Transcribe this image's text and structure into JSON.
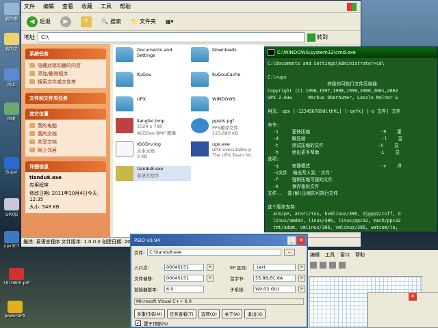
{
  "desktop": {
    "icons": [
      "我的电",
      "我的文",
      "",
      "网上",
      "",
      "回收",
      "",
      "Super",
      "",
      "UPX加",
      "",
      "upx307",
      "",
      "1910800.pdf",
      "",
      "powerUPX"
    ]
  },
  "explorer": {
    "menu": [
      "文件",
      "编辑",
      "查看",
      "收藏",
      "工具",
      "帮助"
    ],
    "toolbar": {
      "back": "后退",
      "search": "搜索",
      "folders": "文件夹"
    },
    "address_label": "地址",
    "address_value": "C:\\",
    "go": "转到",
    "system_tasks": {
      "title": "系统任务",
      "items": [
        "隐藏此驱动器的内容",
        "添加/删除程序",
        "搜索文件或文件夹"
      ]
    },
    "file_tasks": {
      "title": "文件和文件夹任务"
    },
    "other_places": {
      "title": "其它位置",
      "items": [
        "我的电脑",
        "我的文档",
        "共享文档",
        "网上邻居"
      ]
    },
    "details": {
      "title": "详细信息",
      "name": "tiandu8.exe",
      "type": "应用程序",
      "modified": "修改日期: 2011年10月4日今天, 12:35",
      "size": "大小: 548 KB"
    },
    "files": [
      {
        "name": "Documents and Settings",
        "l2": "",
        "l3": ""
      },
      {
        "name": "Downloads",
        "l2": "",
        "l3": ""
      },
      {
        "name": "KuGou",
        "l2": "",
        "l3": ""
      },
      {
        "name": "KuGouCache",
        "l2": "",
        "l3": ""
      },
      {
        "name": "UPX",
        "l2": "",
        "l3": ""
      },
      {
        "name": "WINDOWS",
        "l2": "",
        "l3": ""
      },
      {
        "name": "liangfei.bmp",
        "l2": "1024 x 768",
        "l3": "ACDSee BMP 图像"
      },
      {
        "name": "ppsds.pgf",
        "l2": "PPS缓存文件",
        "l3": "123,680 KB"
      },
      {
        "name": "IGGDrv.log",
        "l2": "文本文档",
        "l3": "0 KB"
      },
      {
        "name": "upx.exe",
        "l2": "UPX executable p",
        "l3": "The UPX Team htt"
      },
      {
        "name": "tiandu8.exe",
        "l2": "易语言程序",
        "l3": ""
      }
    ],
    "status": "描述: 易语言程序 文件版本: 1.0.0.0 创建日期: 2011-10-4 12:35 大小: 547 KB"
  },
  "cmd": {
    "title": "C:\\WINDOWS\\system32\\cmd.exe",
    "lines": [
      "C:\\Documents and Settings\\Administrator>cd\\",
      "",
      "C:\\>upx",
      "                      终极的可执行文件压缩器",
      "Copyright (C) 1996,1997,1998,1999,2000,2001,2002",
      "UPX 2.03w      Markus Oberhumer, Laszlo Molnar &",
      "",
      "用法: upx [-123456789dlthVL] [-qvfk] [-o 文件] 文件",
      "",
      "命令:",
      "  -1     更快压缩                          -9    更",
      "  -d     解压缩                            -l    显",
      "  -t     测试压缩的文件                    -V    显",
      "  -h     给出更多帮助                      -L    显",
      "选项:",
      "  -q     安静模式                          -v    详",
      "  -o文件  输出写入到 '文件'",
      "  -f     强制压缩可疑的文件",
      "  -k     保存备份文件",
      "文件..  要(解)压缩的可执行文件",
      "",
      "这个版本支持:",
      "  arm/pe, atari/tos, bvmlinuz/386, djgpp2/coff, d",
      "  linux/amd64, linux/386, linux/ppc32, mach/ppc32",
      "  tmt/adam, vmlinux/386, vmlinuz/386, watcom/le,"
    ]
  },
  "prog": {
    "menu": [
      "编辑",
      "工具",
      "窗口",
      "帮助"
    ],
    "extra": "助"
  },
  "peid": {
    "title": "PEiD v0.94",
    "file_label": "文件:",
    "file_value": "C:\\tiandu8.exe",
    "entry_label": "入口点:",
    "entry_value": "00045151",
    "file_offset_label": "文件偏移:",
    "file_offset_value": "00045151",
    "linker_label": "链接器版本:",
    "linker_value": "6.0",
    "ep_section_label": "EP 区段:",
    "ep_section_value": ".text",
    "first_bytes_label": "首字节:",
    "first_bytes_value": "55,8B,EC,6A",
    "subsystem_label": "子系统:",
    "subsystem_value": "Win32 GUI",
    "detect": "Microsoft Visual C++ 6.0",
    "buttons": [
      "多重扫描(M)",
      "任务查看(T)",
      "选项(O)",
      "关于(A)",
      "退出(X)"
    ],
    "ontop": "置于顶部(S)"
  }
}
